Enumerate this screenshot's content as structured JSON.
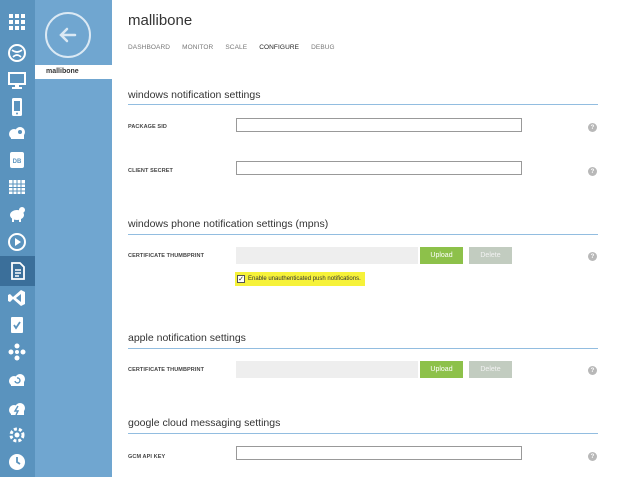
{
  "app": {
    "title": "mallibone"
  },
  "tabs": [
    "DASHBOARD",
    "MONITOR",
    "SCALE",
    "CONFIGURE",
    "DEBUG"
  ],
  "active_tab": "CONFIGURE",
  "panel": {
    "item": "mallibone"
  },
  "rail_icons": [
    "all-items-icon",
    "web-sites-icon",
    "virtual-machines-icon",
    "mobile-services-icon",
    "cloud-services-icon",
    "sql-databases-icon",
    "storage-icon",
    "hdinsight-icon",
    "media-services-icon",
    "service-bus-icon",
    "visual-studio-online-icon",
    "cache-icon",
    "biztalk-services-icon",
    "recovery-services-icon",
    "cdn-icon",
    "automation-icon",
    "scheduler-icon"
  ],
  "sections": {
    "windows": {
      "title": "windows notification settings",
      "package_sid_label": "PACKAGE SID",
      "client_secret_label": "CLIENT SECRET"
    },
    "windows_phone": {
      "title": "windows phone notification settings (mpns)",
      "cert_label": "CERTIFICATE THUMBPRINT",
      "upload": "Upload",
      "delete": "Delete",
      "unauth_label": "Enable unauthenticated push notifications.",
      "unauth_checked": true
    },
    "apple": {
      "title": "apple notification settings",
      "cert_label": "CERTIFICATE THUMBPRINT",
      "upload": "Upload",
      "delete": "Delete"
    },
    "google": {
      "title": "google cloud messaging settings",
      "gcm_label": "GCM API KEY"
    }
  },
  "help_glyph": "?",
  "colors": {
    "rail": "#5a93be",
    "panel": "#70a6d0",
    "upload": "#8dc14a",
    "delete": "#c2ccc0",
    "highlight": "#f6f23a",
    "rule": "#92bde0"
  }
}
